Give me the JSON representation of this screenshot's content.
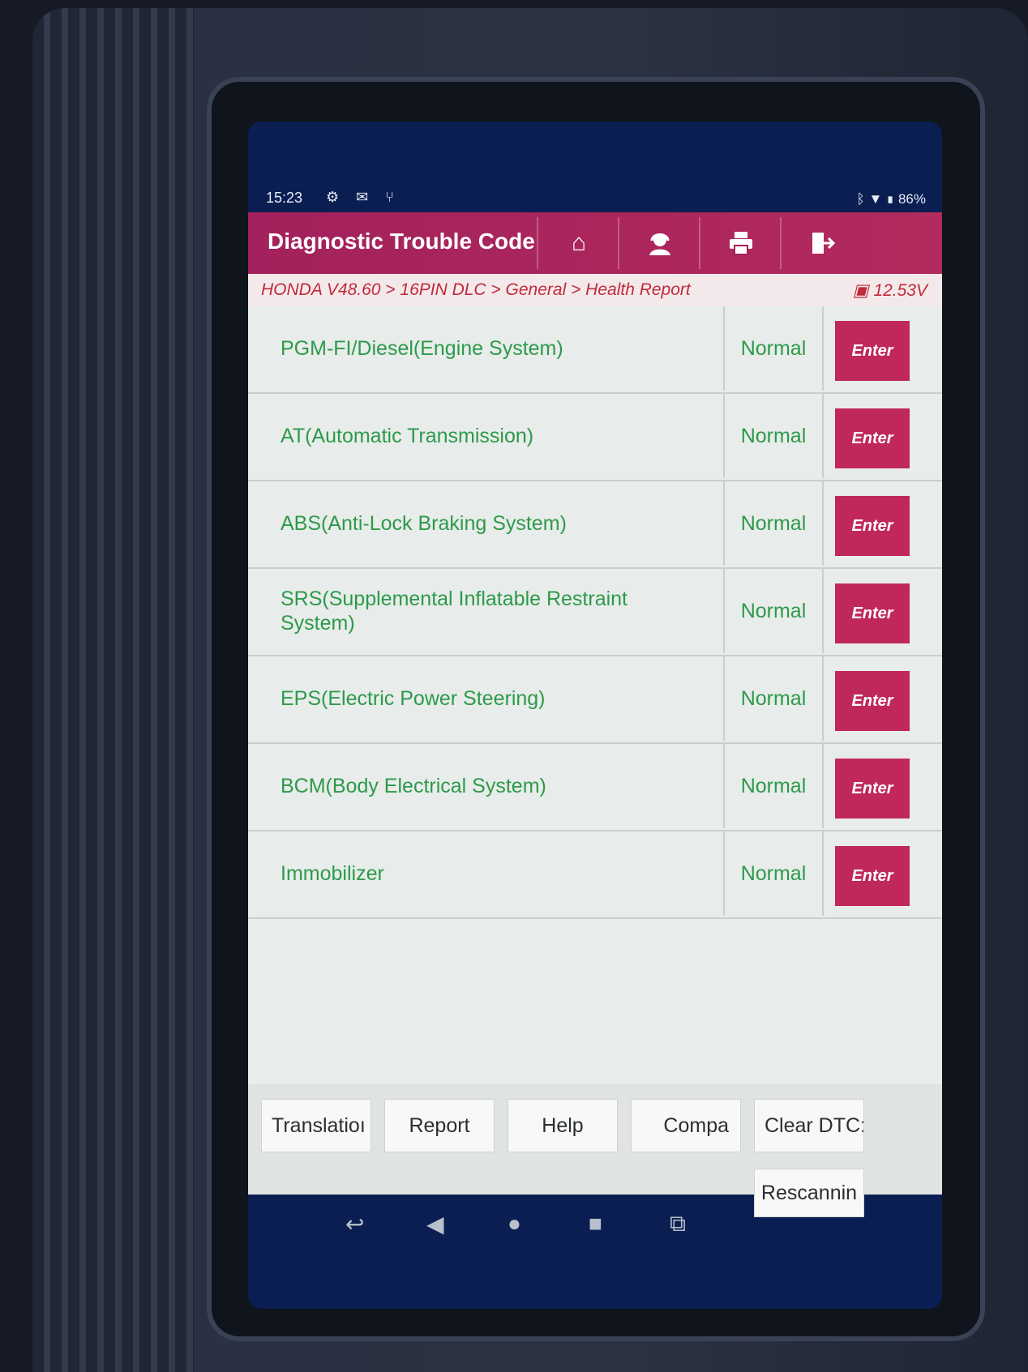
{
  "status_bar": {
    "time": "15:23",
    "battery": "86%"
  },
  "header": {
    "title": "Diagnostic Trouble Code",
    "buttons": [
      "home-icon",
      "support-agent-icon",
      "printer-icon",
      "exit-icon"
    ]
  },
  "breadcrumb": {
    "path": "HONDA V48.60 > 16PIN DLC > General > Health Report",
    "voltage": "12.53V"
  },
  "systems": [
    {
      "name": "PGM-FI/Diesel(Engine System)",
      "status": "Normal",
      "action": "Enter"
    },
    {
      "name": "AT(Automatic Transmission)",
      "status": "Normal",
      "action": "Enter"
    },
    {
      "name": "ABS(Anti-Lock Braking System)",
      "status": "Normal",
      "action": "Enter"
    },
    {
      "name": "SRS(Supplemental Inflatable Restraint System)",
      "status": "Normal",
      "action": "Enter"
    },
    {
      "name": "EPS(Electric Power Steering)",
      "status": "Normal",
      "action": "Enter"
    },
    {
      "name": "BCM(Body Electrical System)",
      "status": "Normal",
      "action": "Enter"
    },
    {
      "name": "Immobilizer",
      "status": "Normal",
      "action": "Enter"
    }
  ],
  "footer": {
    "translation": "Translatioı",
    "report": "Report",
    "help": "Help",
    "compare": "Compa",
    "clear_dtcs": "Clear DTC:",
    "rescanning": "Rescannin"
  },
  "colors": {
    "header": "#a3215c",
    "enter_button": "#c0285a",
    "status_text": "#2d9a4a",
    "breadcrumb_text": "#c02a3c"
  }
}
